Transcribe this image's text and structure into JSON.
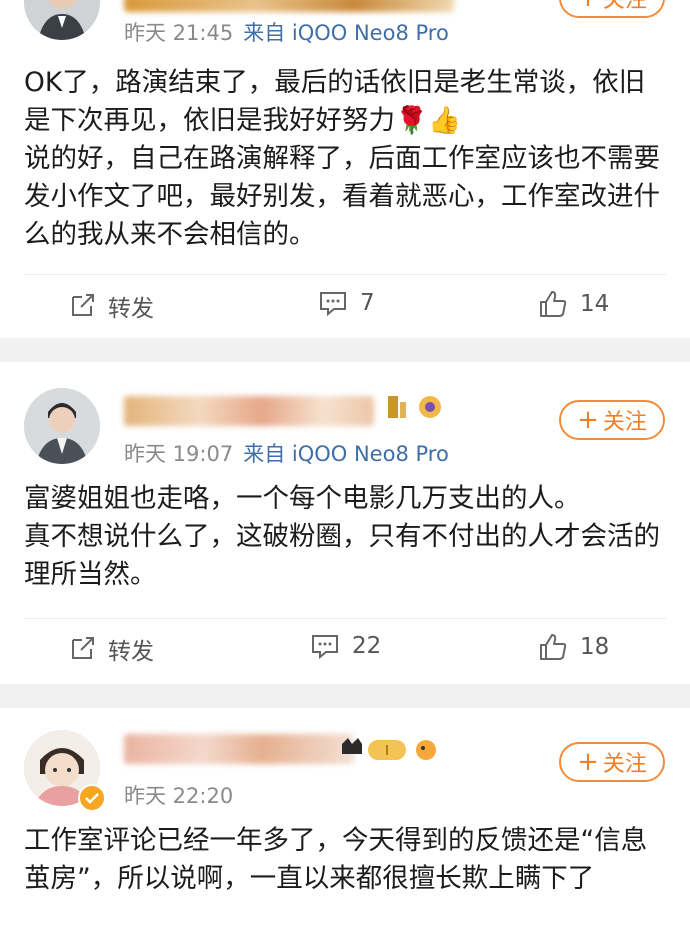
{
  "posts": [
    {
      "time": "昨天 21:45",
      "device": "来自 iQOO Neo8 Pro",
      "follow_label": "关注",
      "content": [
        "OK了，路演结束了，最后的话依旧是老生常谈，依旧是下次再见，依旧是我好好努力🌹👍",
        "说的好，自己在路演解释了，后面工作室应该也不需要发小作文了吧，最好别发，看着就恶心，工作室改进什么的我从来不会相信的。"
      ],
      "repost_label": "转发",
      "comments": "7",
      "likes": "14"
    },
    {
      "time": "昨天 19:07",
      "device": "来自 iQOO Neo8 Pro",
      "follow_label": "关注",
      "content": [
        "富婆姐姐也走咯，一个每个电影几万支出的人。",
        "真不想说什么了，这破粉圈，只有不付出的人才会活的理所当然。"
      ],
      "repost_label": "转发",
      "comments": "22",
      "likes": "18"
    },
    {
      "time": "昨天 22:20",
      "device": "",
      "follow_label": "关注",
      "content": [
        "工作室评论已经一年多了，今天得到的反馈还是“信息茧房”，所以说啊，一直以来都很擅长欺上瞒下了"
      ]
    }
  ],
  "colors": {
    "accent": "#ef7f24",
    "link": "#3f6ea8",
    "meta": "#8a8a8a"
  }
}
